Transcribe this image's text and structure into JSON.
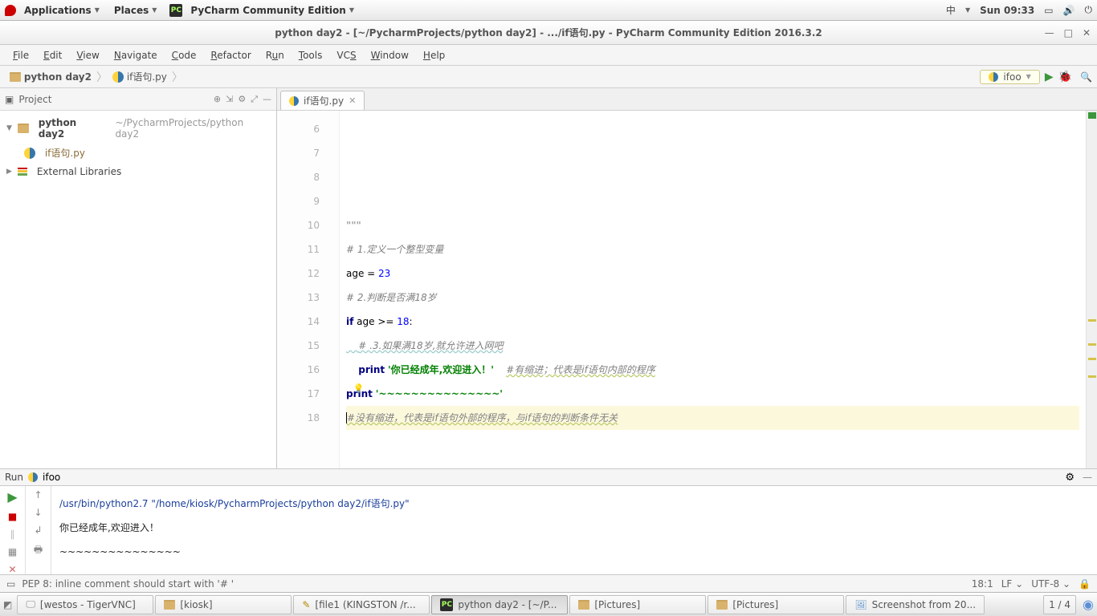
{
  "panel": {
    "applications": "Applications",
    "places": "Places",
    "app_title": "PyCharm Community Edition",
    "ime": "中",
    "clock": "Sun 09:33"
  },
  "window_title": "python day2 - [~/PycharmProjects/python day2] - .../if语句.py - PyCharm Community Edition 2016.3.2",
  "menu": {
    "file": "File",
    "edit": "Edit",
    "view": "View",
    "navigate": "Navigate",
    "code": "Code",
    "refactor": "Refactor",
    "run": "Run",
    "tools": "Tools",
    "vcs": "VCS",
    "window": "Window",
    "help": "Help"
  },
  "breadcrumb": {
    "root": "python day2",
    "file": "if语句.py"
  },
  "run_config": "ifoo",
  "sidebar": {
    "title": "Project",
    "root_name": "python day2",
    "root_path": "~/PycharmProjects/python day2",
    "file": "if语句.py",
    "ext_libs": "External Libraries"
  },
  "tab": {
    "name": "if语句.py"
  },
  "gutter_start": 6,
  "gutter_end": 18,
  "code_lines": [
    {
      "n": 6,
      "html": ""
    },
    {
      "n": 7,
      "html": ""
    },
    {
      "n": 8,
      "html": ""
    },
    {
      "n": 9,
      "html": ""
    },
    {
      "n": 10,
      "html": "<span class='py-doc'>\"\"\"</span>"
    },
    {
      "n": 11,
      "html": "<span class='py-com'># 1.定义一个整型变量</span>"
    },
    {
      "n": 12,
      "html": "age = <span class='py-num'>23</span>"
    },
    {
      "n": 13,
      "html": "<span class='py-com'># 2.判断是否满18岁</span>"
    },
    {
      "n": 14,
      "html": "<span class='py-kw'>if</span> age &gt;= <span class='py-num'>18</span>:"
    },
    {
      "n": 15,
      "html": "<span class='wavy-g'>    <span class='py-com'># .3.如果满18岁,就允许进入网吧</span></span>"
    },
    {
      "n": 16,
      "html": "    <span class='py-kw'>print</span> <span class='py-str'>'你已经成年,欢迎进入！'</span>    <span class='py-com wavy'>#有缩进；代表是if语句内部的程序</span>"
    },
    {
      "n": 17,
      "html": "<span class='py-kw'>p<span style='position:relative'>r<span style='position:absolute;left:0;bottom:-2px;font-size:11px'>💡</span></span>int</span> <span class='py-str'>'~~~~~~~~~~~~~~~'</span>"
    },
    {
      "n": 18,
      "hl": true,
      "html": "<span style='border-left:1px solid #000'></span><span class='py-com wavy'>#没有缩进，代表是if语句外部的程序，与if语句的判断条件无关</span>"
    }
  ],
  "run_head": {
    "label": "Run",
    "cfg": "ifoo"
  },
  "console": {
    "cmd": "/usr/bin/python2.7 \"/home/kiosk/PycharmProjects/python day2/if语句.py\"",
    "line1": "你已经成年,欢迎进入！",
    "line2": "~~~~~~~~~~~~~~~"
  },
  "status": {
    "msg": "PEP 8: inline comment should start with '# '",
    "pos": "18:1",
    "le": "LF",
    "enc": "UTF-8"
  },
  "taskbar": {
    "items": [
      {
        "label": "[westos - TigerVNC]",
        "icon": "screen"
      },
      {
        "label": "[kiosk]",
        "icon": "folder"
      },
      {
        "label": "[file1 (KINGSTON /r...",
        "icon": "edit"
      },
      {
        "label": "python day2 - [~/P...",
        "icon": "pc",
        "active": true
      },
      {
        "label": "[Pictures]",
        "icon": "folder"
      },
      {
        "label": "[Pictures]",
        "icon": "folder"
      },
      {
        "label": "Screenshot from 20...",
        "icon": "pic"
      }
    ],
    "ws": "1 / 4"
  }
}
